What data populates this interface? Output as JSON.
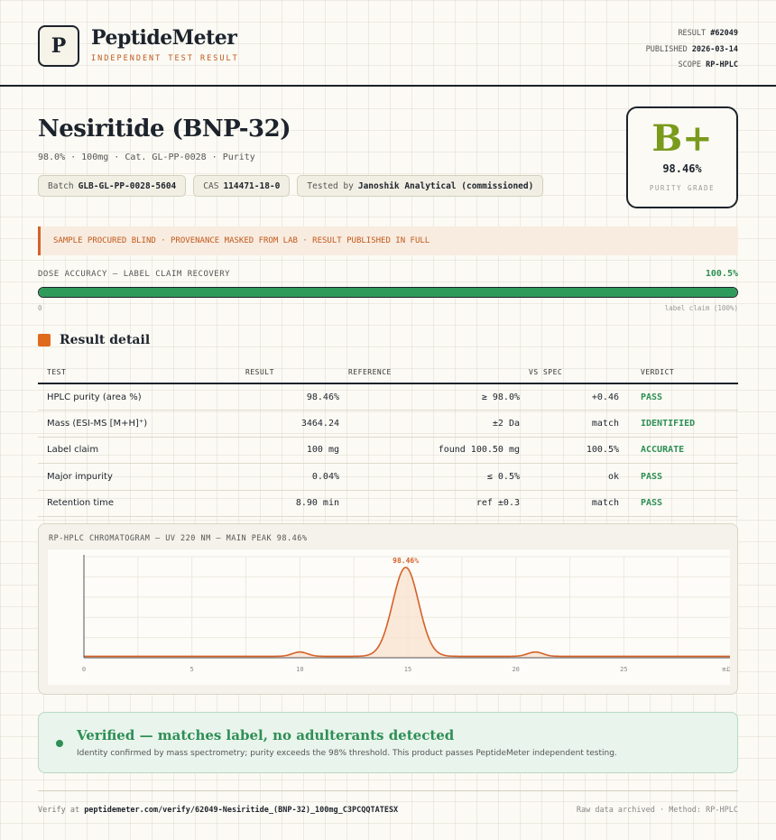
{
  "header": {
    "logo_letter": "P",
    "brand": "PeptideMeter",
    "brand_sub": "INDEPENDENT TEST RESULT",
    "result_label": "RESULT",
    "result_value": "#62049",
    "published_label": "PUBLISHED",
    "published_value": "2026-03-14",
    "scope_label": "SCOPE",
    "scope_value": "RP-HPLC"
  },
  "product": {
    "title": "Nesiritide (BNP-32)",
    "subtitle": "98.0% · 100mg · Cat. GL-PP-0028 · Purity",
    "chips": [
      {
        "label": "Batch",
        "value": "GLB-GL-PP-0028-5604"
      },
      {
        "label": "CAS",
        "value": "114471-18-0"
      },
      {
        "label": "Tested by",
        "value": "Janoshik Analytical (commissioned)"
      }
    ]
  },
  "grade": {
    "letter": "B+",
    "percent": "98.46%",
    "label": "PURITY GRADE",
    "color": "#7a9a1c"
  },
  "notice": "SAMPLE PROCURED BLIND · PROVENANCE MASKED FROM LAB · RESULT PUBLISHED IN FULL",
  "dose": {
    "label": "DOSE ACCURACY — LABEL CLAIM RECOVERY",
    "value_text": "100.5%",
    "fill_fraction": 1.0,
    "min_label": "0",
    "max_label": "label claim (100%)"
  },
  "results": {
    "title": "Result detail",
    "headers": {
      "test": "TEST",
      "result": "RESULT",
      "reference": "REFERENCE",
      "vs_spec": "VS SPEC",
      "verdict": "VERDICT"
    },
    "rows": [
      {
        "test": "HPLC purity (area %)",
        "result": "98.46%",
        "reference": "≥ 98.0%",
        "vs_spec": "+0.46",
        "verdict": "PASS"
      },
      {
        "test": "Mass (ESI-MS [M+H]⁺)",
        "result": "3464.24",
        "reference": "±2 Da",
        "vs_spec": "match",
        "verdict": "IDENTIFIED"
      },
      {
        "test": "Label claim",
        "result": "100 mg",
        "reference": "found 100.50 mg",
        "vs_spec": "100.5%",
        "verdict": "ACCURATE"
      },
      {
        "test": "Major impurity",
        "result": "0.04%",
        "reference": "≤ 0.5%",
        "vs_spec": "ok",
        "verdict": "PASS"
      },
      {
        "test": "Retention time",
        "result": "8.90 min",
        "reference": "ref ±0.3",
        "vs_spec": "match",
        "verdict": "PASS"
      }
    ]
  },
  "chart_data": {
    "type": "line",
    "title": "RP-HPLC CHROMATOGRAM — UV 220 NM — MAIN PEAK 98.46%",
    "xlabel": "",
    "ylabel": "",
    "xlim": [
      0,
      30
    ],
    "ylim": [
      0,
      100
    ],
    "x_ticks": [
      "0",
      "5",
      "10",
      "15",
      "20",
      "25",
      "30"
    ],
    "x_unit_label": "min",
    "grid": true,
    "peaks": [
      {
        "center": 10.0,
        "height": 4.5,
        "width": 0.35
      },
      {
        "center": 14.9,
        "height": 93,
        "width": 0.6,
        "label": "98.46%"
      },
      {
        "center": 20.9,
        "height": 4.5,
        "width": 0.35
      }
    ],
    "baseline": 1.5,
    "line_color": "#d4622a",
    "fill_color": "#f9e2d0"
  },
  "verified": {
    "title": "Verified — matches label, no adulterants detected",
    "description": "Identity confirmed by mass spectrometry; purity exceeds the 98% threshold. This product passes PeptideMeter independent testing."
  },
  "footer": {
    "verify_prefix": "Verify at",
    "verify_url": "peptidemeter.com/verify/62049-Nesiritide_(BNP-32)_100mg_C3PCQQTATESX",
    "right_text": "Raw data archived · Method: RP-HPLC"
  }
}
